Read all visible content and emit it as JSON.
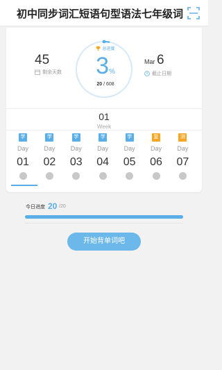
{
  "header": {
    "title": "初中同步词汇短语句型语法七年级词汇"
  },
  "stats": {
    "days_learned": "45",
    "days_learned_label": "剩余天数",
    "ring_label": "总进度",
    "percent": "3",
    "percent_sign": "%",
    "learned": "20",
    "total": "/ 608",
    "deadline_month": "Mar",
    "deadline_day": "6",
    "deadline_label": "截止日期",
    "progress_fraction": 0.033
  },
  "week": {
    "number": "01",
    "label": "Week"
  },
  "days": [
    {
      "badge": "学",
      "label": "Day",
      "num": "01",
      "color": "#5aaee8"
    },
    {
      "badge": "学",
      "label": "Day",
      "num": "02",
      "color": "#5aaee8"
    },
    {
      "badge": "学",
      "label": "Day",
      "num": "03",
      "color": "#5aaee8"
    },
    {
      "badge": "学",
      "label": "Day",
      "num": "04",
      "color": "#5aaee8"
    },
    {
      "badge": "学",
      "label": "Day",
      "num": "05",
      "color": "#5aaee8"
    },
    {
      "badge": "复",
      "label": "Day",
      "num": "06",
      "color": "#f5a623"
    },
    {
      "badge": "测",
      "label": "Day",
      "num": "07",
      "color": "#f5a623"
    }
  ],
  "today": {
    "label": "今日进度",
    "value": "20",
    "total": "/20",
    "fraction": 1.0
  },
  "start_button": {
    "label": "开始背单词吧"
  },
  "colors": {
    "accent": "#5aaee8",
    "review": "#f5a623"
  }
}
